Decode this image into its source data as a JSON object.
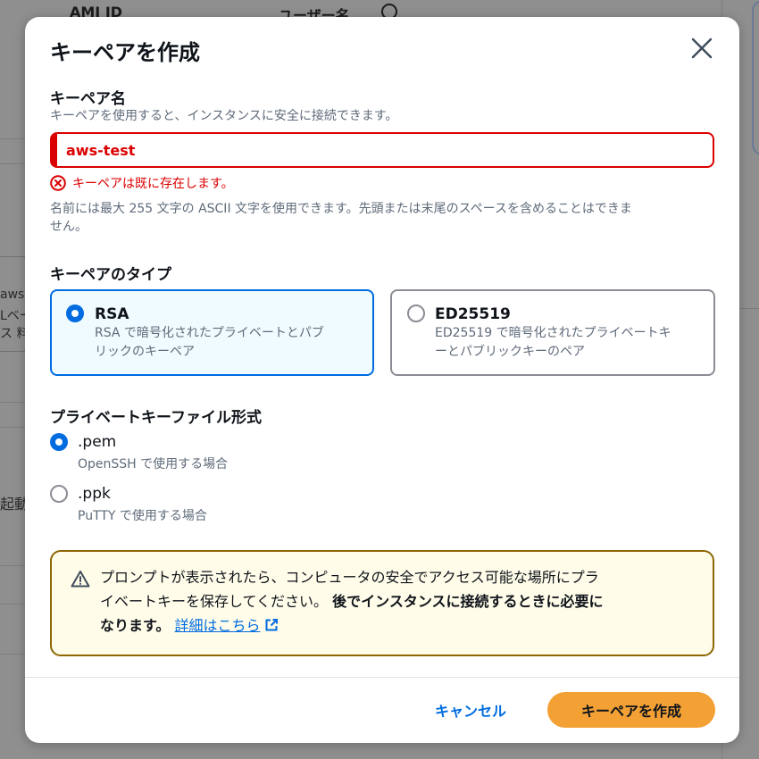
{
  "background": {
    "header_col1": "AMI ID",
    "header_col2": "ユーザー名",
    "fragments": [
      "aws",
      "Lベー",
      "ス 料",
      "起動で"
    ]
  },
  "modal": {
    "title": "キーペアを作成",
    "key_name": {
      "label": "キーペア名",
      "description": "キーペアを使用すると、インスタンスに安全に接続できます。",
      "value": "aws-test",
      "error": "キーペアは既に存在します。",
      "constraint_line1": "名前には最大 255 文字の ASCII 文字を使用できます。先頭または末尾のスペースを含めることはできま",
      "constraint_line2": "せん。"
    },
    "key_type": {
      "label": "キーペアのタイプ",
      "options": [
        {
          "title": "RSA",
          "desc_line1": "RSA で暗号化されたプライベートとパブ",
          "desc_line2": "リックのキーペア",
          "selected": true
        },
        {
          "title": "ED25519",
          "desc_line1": "ED25519 で暗号化されたプライベートキ",
          "desc_line2": "ーとパブリックキーのペア",
          "selected": false
        }
      ]
    },
    "file_format": {
      "label": "プライベートキーファイル形式",
      "options": [
        {
          "title": ".pem",
          "desc": "OpenSSH で使用する場合",
          "selected": true
        },
        {
          "title": ".ppk",
          "desc": "PuTTY で使用する場合",
          "selected": false
        }
      ]
    },
    "alert": {
      "line1": "プロンプトが表示されたら、コンピュータの安全でアクセス可能な場所にプラ",
      "line2_normal": "イベートキーを保存してください。",
      "line2_bold": "後でインスタンスに接続するときに必要に",
      "line3_bold": "なります。",
      "link": "詳細はこちら"
    },
    "buttons": {
      "cancel": "キャンセル",
      "create": "キーペアを作成"
    }
  },
  "colors": {
    "primary": "#006ce0",
    "error": "#db0000",
    "warning_border": "#8d6605",
    "warning_bg": "#fffce9",
    "create_button": "#f3a035"
  }
}
